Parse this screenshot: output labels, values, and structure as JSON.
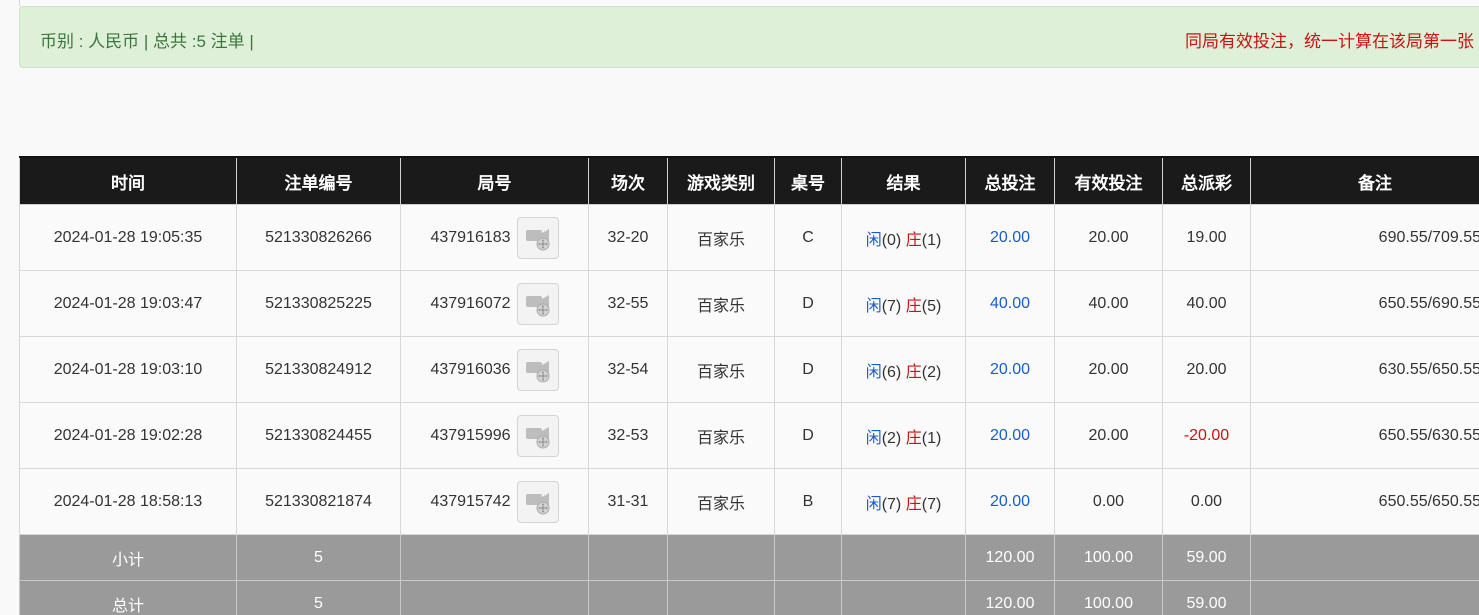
{
  "summary": {
    "currency_text": "币别 : 人民币 | 总共 :5 注单 |",
    "notice_text": "同局有效投注，统一计算在该局第一张"
  },
  "table": {
    "columns": [
      "时间",
      "注单编号",
      "局号",
      "场次",
      "游戏类别",
      "桌号",
      "结果",
      "总投注",
      "有效投注",
      "总派彩",
      "备注"
    ],
    "rows": [
      {
        "time": "2024-01-28 19:05:35",
        "order_no": "521330826266",
        "round_no": "437916183",
        "session": "32-20",
        "game": "百家乐",
        "table_no": "C",
        "result": {
          "player_label": "闲",
          "player_value": "(0)",
          "banker_label": "庄",
          "banker_value": "(1)"
        },
        "total_bet": "20.00",
        "valid_bet": "20.00",
        "payout": "19.00",
        "note": "690.55/709.55"
      },
      {
        "time": "2024-01-28 19:03:47",
        "order_no": "521330825225",
        "round_no": "437916072",
        "session": "32-55",
        "game": "百家乐",
        "table_no": "D",
        "result": {
          "player_label": "闲",
          "player_value": "(7)",
          "banker_label": "庄",
          "banker_value": "(5)"
        },
        "total_bet": "40.00",
        "valid_bet": "40.00",
        "payout": "40.00",
        "note": "650.55/690.55"
      },
      {
        "time": "2024-01-28 19:03:10",
        "order_no": "521330824912",
        "round_no": "437916036",
        "session": "32-54",
        "game": "百家乐",
        "table_no": "D",
        "result": {
          "player_label": "闲",
          "player_value": "(6)",
          "banker_label": "庄",
          "banker_value": "(2)"
        },
        "total_bet": "20.00",
        "valid_bet": "20.00",
        "payout": "20.00",
        "note": "630.55/650.55"
      },
      {
        "time": "2024-01-28 19:02:28",
        "order_no": "521330824455",
        "round_no": "437915996",
        "session": "32-53",
        "game": "百家乐",
        "table_no": "D",
        "result": {
          "player_label": "闲",
          "player_value": "(2)",
          "banker_label": "庄",
          "banker_value": "(1)"
        },
        "total_bet": "20.00",
        "valid_bet": "20.00",
        "payout": "-20.00",
        "note": "650.55/630.55"
      },
      {
        "time": "2024-01-28 18:58:13",
        "order_no": "521330821874",
        "round_no": "437915742",
        "session": "31-31",
        "game": "百家乐",
        "table_no": "B",
        "result": {
          "player_label": "闲",
          "player_value": "(7)",
          "banker_label": "庄",
          "banker_value": "(7)"
        },
        "total_bet": "20.00",
        "valid_bet": "0.00",
        "payout": "0.00",
        "note": "650.55/650.55"
      }
    ],
    "subtotal": {
      "label": "小计",
      "count": "5",
      "total_bet": "120.00",
      "valid_bet": "100.00",
      "payout": "59.00"
    },
    "total": {
      "label": "总计",
      "count": "5",
      "total_bet": "120.00",
      "valid_bet": "100.00",
      "payout": "59.00"
    }
  },
  "colors": {
    "header_bg": "#1a1a1a",
    "alert_bg": "#dff0d8",
    "alert_text": "#3c763d",
    "notice_text": "#cc1111",
    "bet_blue": "#1a5ccc",
    "loss_red": "#cc1111",
    "sum_row_bg": "#9a9a9a"
  },
  "icons": {
    "replay": "video-replay-icon"
  }
}
